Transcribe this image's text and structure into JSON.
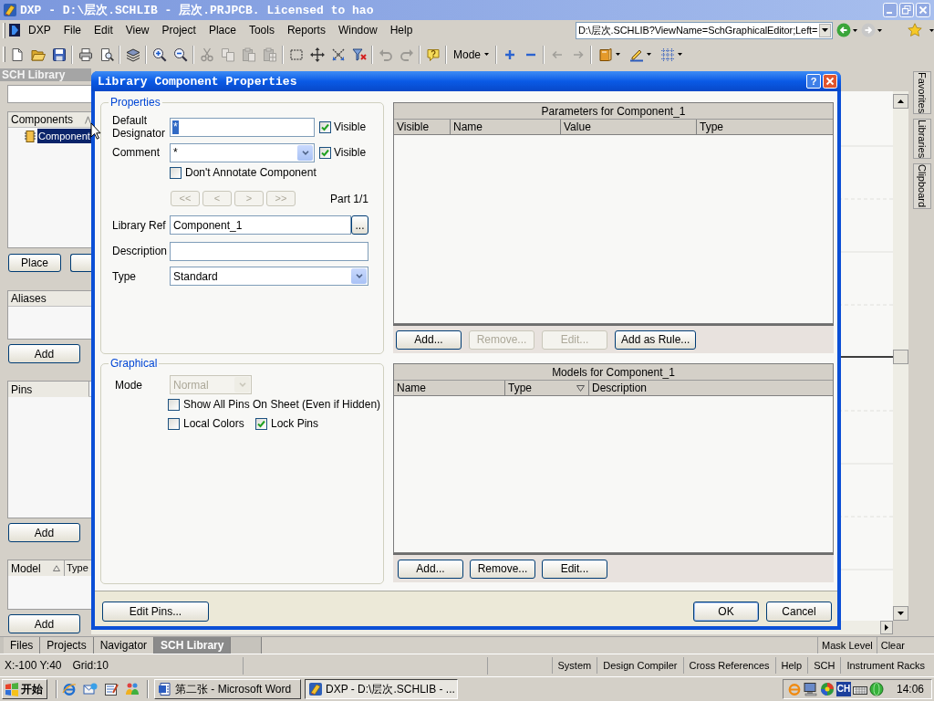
{
  "window": {
    "title": "DXP - D:\\层次.SCHLIB - 层次.PRJPCB. Licensed to hao"
  },
  "menu": [
    "DXP",
    "File",
    "Edit",
    "View",
    "Project",
    "Place",
    "Tools",
    "Reports",
    "Window",
    "Help"
  ],
  "address_bar": {
    "value": "D:\\层次.SCHLIB?ViewName=SchGraphicalEditor;Left="
  },
  "toolbar": [
    {
      "kind": "button",
      "disabled": false
    },
    {
      "kind": "button",
      "disabled": false
    },
    {
      "kind": "button",
      "disabled": false
    },
    {
      "kind": "separator"
    },
    {
      "kind": "button",
      "disabled": false
    },
    {
      "kind": "button",
      "disabled": false
    },
    {
      "kind": "separator"
    },
    {
      "kind": "button",
      "disabled": false
    },
    {
      "kind": "separator"
    },
    {
      "kind": "button",
      "disabled": false
    },
    {
      "kind": "button",
      "disabled": false
    },
    {
      "kind": "separator"
    },
    {
      "kind": "button",
      "disabled": true
    },
    {
      "kind": "button",
      "disabled": true
    },
    {
      "kind": "button",
      "disabled": true
    },
    {
      "kind": "button",
      "disabled": true
    },
    {
      "kind": "separator"
    },
    {
      "kind": "button",
      "disabled": false
    },
    {
      "kind": "button",
      "disabled": false
    },
    {
      "kind": "button",
      "disabled": false
    },
    {
      "kind": "button",
      "disabled": false
    },
    {
      "kind": "separator"
    },
    {
      "kind": "button",
      "disabled": true
    },
    {
      "kind": "button",
      "disabled": true
    },
    {
      "kind": "separator"
    },
    {
      "kind": "button",
      "disabled": false
    },
    {
      "kind": "separator"
    },
    {
      "kind": "text_menu",
      "label": "Mode"
    },
    {
      "kind": "separator"
    },
    {
      "kind": "button",
      "disabled": false
    },
    {
      "kind": "button",
      "disabled": false
    },
    {
      "kind": "separator"
    },
    {
      "kind": "button",
      "disabled": true
    },
    {
      "kind": "button",
      "disabled": true
    },
    {
      "kind": "separator"
    },
    {
      "kind": "menu_button",
      "disabled": false
    },
    {
      "kind": "menu_button",
      "disabled": false
    },
    {
      "kind": "menu_button",
      "disabled": false
    }
  ],
  "sch_library_panel": {
    "title": "SCH Library",
    "components": {
      "header": "Components",
      "items": [
        {
          "label": "Component",
          "selected": true
        }
      ]
    },
    "place_button": "Place",
    "aliases": {
      "header": "Aliases",
      "add_button": "Add"
    },
    "pins": {
      "header": "Pins",
      "add_button": "Add"
    },
    "models": {
      "columns": [
        "Model",
        "Type"
      ],
      "add_button": "Add"
    }
  },
  "dialog": {
    "title": "Library Component Properties",
    "help_button": "?",
    "properties": {
      "title": "Properties",
      "default_designator": {
        "label": "Default Designator",
        "value": "*",
        "value_selected": true,
        "visible": {
          "label": "Visible",
          "checked": true
        }
      },
      "comment": {
        "label": "Comment",
        "value": "*",
        "visible": {
          "label": "Visible",
          "checked": true
        }
      },
      "dont_annotate": {
        "label": "Don't Annotate Component",
        "checked": false
      },
      "part_buttons": [
        {
          "label": "<<",
          "disabled": true
        },
        {
          "label": "<",
          "disabled": true
        },
        {
          "label": ">",
          "disabled": true
        },
        {
          "label": ">>",
          "disabled": true
        }
      ],
      "part": "Part 1/1",
      "library_ref": {
        "label": "Library Ref",
        "value": "Component_1",
        "browse_button": "..."
      },
      "description": {
        "label": "Description"
      },
      "type": {
        "label": "Type",
        "value": "Standard"
      }
    },
    "graphical": {
      "title": "Graphical",
      "mode": {
        "label": "Mode",
        "value": "Normal",
        "disabled": true
      },
      "checkboxes": [
        {
          "label": "Show All Pins On Sheet (Even if Hidden)",
          "checked": false
        },
        {
          "label": "Local Colors",
          "checked": false
        },
        {
          "label": "Lock Pins",
          "checked": true
        }
      ]
    },
    "parameters": {
      "title": "Parameters for Component_1",
      "columns": [
        "Visible",
        "Name",
        "Value",
        "Type"
      ],
      "buttons": [
        {
          "label": "Add...",
          "disabled": false
        },
        {
          "label": "Remove...",
          "disabled": true
        },
        {
          "label": "Edit...",
          "disabled": true
        },
        {
          "label": "Add as Rule...",
          "disabled": false
        }
      ]
    },
    "models": {
      "title": "Models for Component_1",
      "columns": [
        "Name",
        "Type",
        "Description"
      ],
      "buttons": [
        {
          "label": "Add...",
          "disabled": false
        },
        {
          "label": "Remove...",
          "disabled": false
        },
        {
          "label": "Edit...",
          "disabled": false
        }
      ]
    },
    "buttons": {
      "edit_pins": "Edit Pins...",
      "ok": "OK",
      "cancel": "Cancel"
    }
  },
  "panel_tabs": [
    {
      "label": "Files",
      "selected": false
    },
    {
      "label": "Projects",
      "selected": false
    },
    {
      "label": "Navigator",
      "selected": false
    },
    {
      "label": "SCH Library",
      "selected": true
    }
  ],
  "panel_controls": [
    "Mask Level",
    "Clear"
  ],
  "right_panel_tabs": [
    "Favorites",
    "Libraries",
    "Clipboard"
  ],
  "status_bar": {
    "position": "X:-100 Y:40",
    "grid": "Grid:10",
    "panels": [
      "System",
      "Design Compiler",
      "Cross References",
      "Help",
      "SCH",
      "Instrument Racks"
    ]
  },
  "taskbar": {
    "start": "开始",
    "tasks": [
      {
        "label": "第二张 - Microsoft Word",
        "selected": false
      },
      {
        "label": "DXP - D:\\层次.SCHLIB - ...",
        "selected": true
      }
    ],
    "ime": "CH",
    "clock": "14:06"
  }
}
